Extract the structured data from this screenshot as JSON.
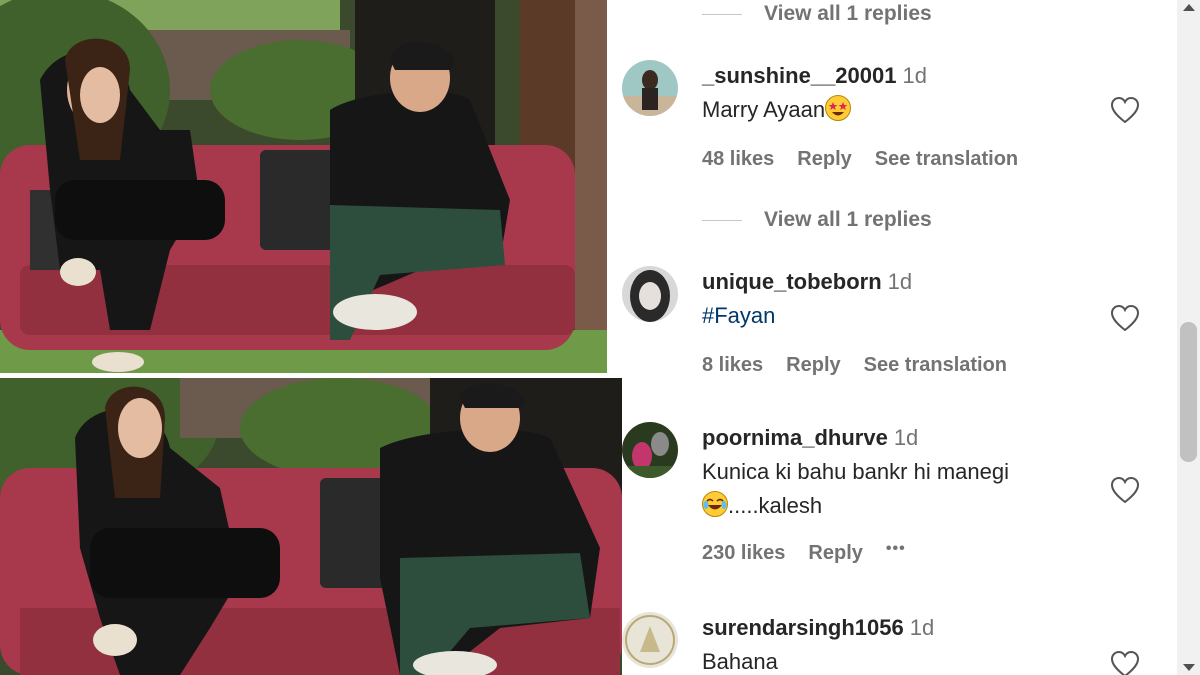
{
  "replies": [
    {
      "label": "View all 1 replies"
    },
    {
      "label": "View all 1 replies"
    }
  ],
  "comments": [
    {
      "username": "_sunshine__20001",
      "time": "1d",
      "text": "Marry Ayaan",
      "emoji": "star-struck-emoji",
      "likes": "48 likes",
      "reply": "Reply",
      "translate": "See translation"
    },
    {
      "username": "unique_tobeborn",
      "time": "1d",
      "text": "#Fayan",
      "likes": "8 likes",
      "reply": "Reply",
      "translate": "See translation"
    },
    {
      "username": "poornima_dhurve",
      "time": "1d",
      "text": "Kunica ki bahu bankr hi manegi",
      "text2": ".....kalesh",
      "emoji": "laughing-emoji",
      "likes": "230 likes",
      "reply": "Reply",
      "more": "•••"
    },
    {
      "username": "surendarsingh1056",
      "time": "1d",
      "text": "Bahana"
    }
  ],
  "colors": {
    "link": "#00376b",
    "muted": "#737373",
    "text": "#262626"
  }
}
